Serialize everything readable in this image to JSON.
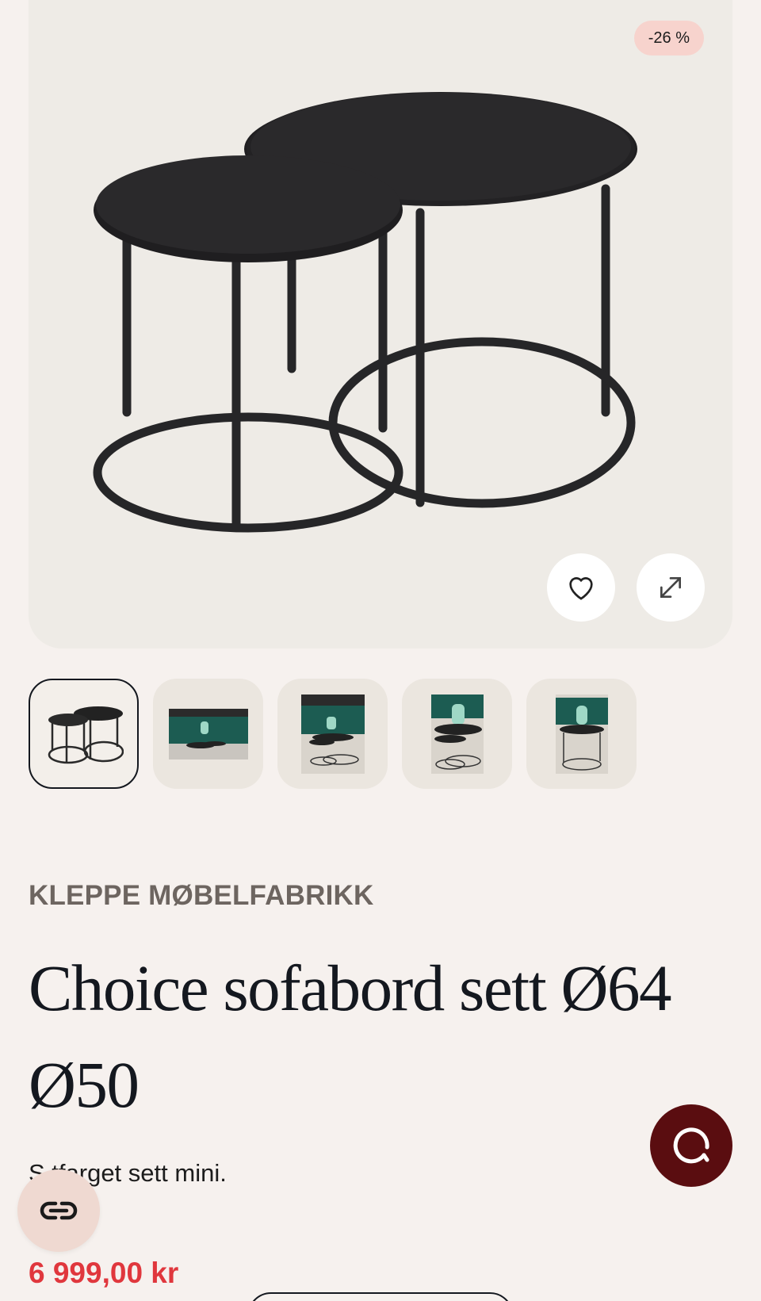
{
  "product": {
    "discount_badge": "-26 %",
    "brand": "KLEPPE MØBELFABRIKK",
    "title": "Choice sofabord sett Ø64 Ø50",
    "description": "Sortfarget sett mini.",
    "description_visible": "S   tfarget sett mini.",
    "price": "6 999,00 kr"
  },
  "gallery": {
    "thumbnails": [
      {
        "name": "thumb-tables",
        "active": true
      },
      {
        "name": "thumb-living-room-1",
        "active": false
      },
      {
        "name": "thumb-living-room-2",
        "active": false
      },
      {
        "name": "thumb-living-room-3",
        "active": false
      },
      {
        "name": "thumb-living-room-4",
        "active": false
      }
    ]
  },
  "icons": {
    "favorite": "heart-icon",
    "expand": "expand-icon",
    "chat": "chat-icon",
    "compare": "compare-icon"
  },
  "colors": {
    "background": "#f6f1ee",
    "hero_background": "#eeebe6",
    "badge_background": "#f7d3cd",
    "price": "#e0373d",
    "chat_button": "#5a0d10",
    "compare_button": "#efd9d1",
    "brand_text": "#6d6560"
  }
}
